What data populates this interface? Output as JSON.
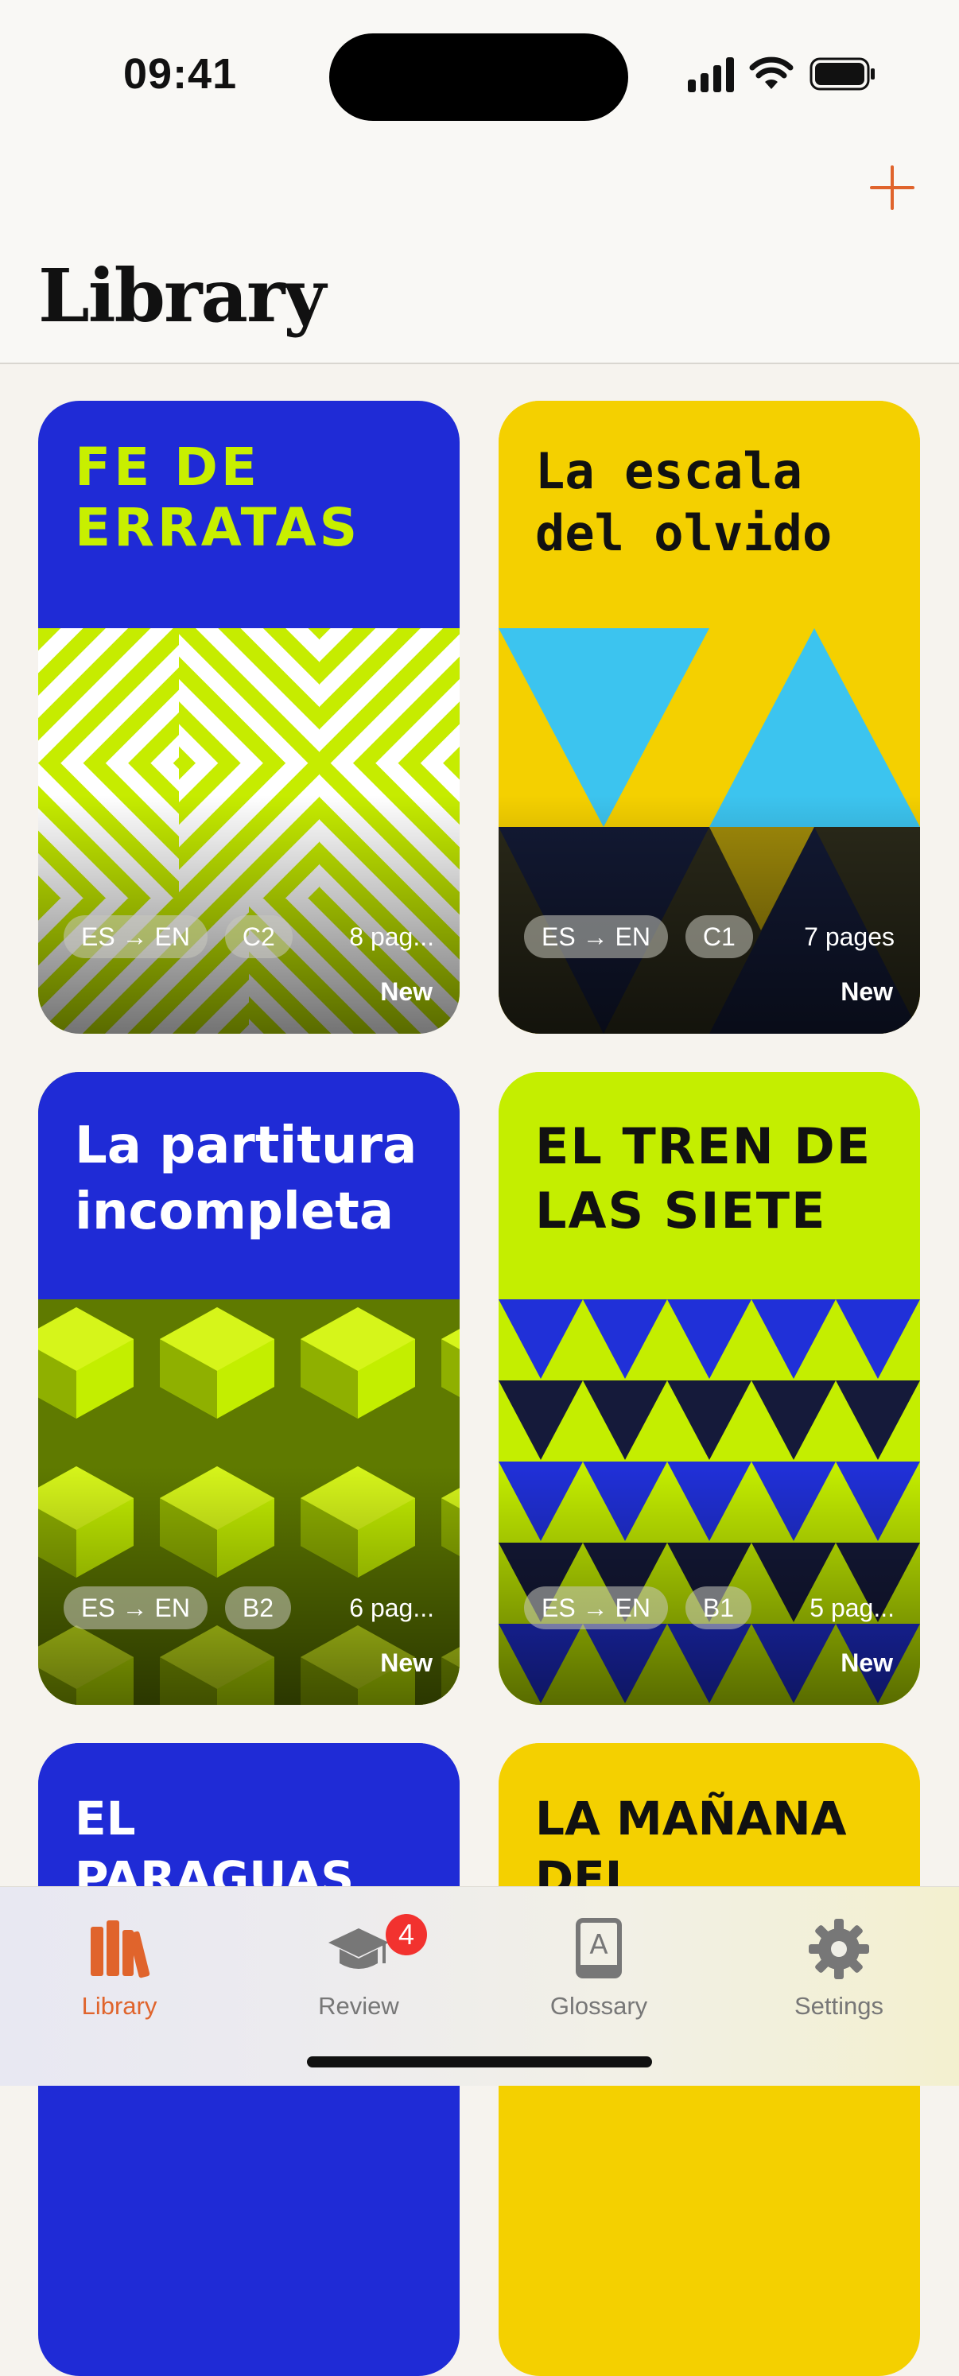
{
  "status_bar": {
    "time": "09:41"
  },
  "header": {
    "title": "Library",
    "add_icon": "plus-icon"
  },
  "books": [
    {
      "title": "FE DE ERRATAS",
      "lang": "ES → EN",
      "level": "C2",
      "pages": "8 pag...",
      "status": "New",
      "top_color": "#1f2bd6",
      "title_color": "#c8ef00"
    },
    {
      "title": "La escala del olvido",
      "lang": "ES → EN",
      "level": "C1",
      "pages": "7 pages",
      "status": "New",
      "top_color": "#f4d000",
      "title_color": "#111111"
    },
    {
      "title": "La partitura incompleta",
      "lang": "ES → EN",
      "level": "B2",
      "pages": "6 pag...",
      "status": "New",
      "top_color": "#1f2bd6",
      "title_color": "#ffffff"
    },
    {
      "title": "EL TREN DE LAS SIETE",
      "lang": "ES → EN",
      "level": "B1",
      "pages": "5 pag...",
      "status": "New",
      "top_color": "#c4ee00",
      "title_color": "#111111"
    },
    {
      "title": "EL PARAGUAS",
      "top_color": "#1f2bd6",
      "title_color": "#ffffff"
    },
    {
      "title": "LA MAÑANA DEL",
      "top_color": "#f4d000",
      "title_color": "#111111"
    }
  ],
  "tabbar": {
    "tabs": [
      {
        "label": "Library",
        "icon": "books-icon",
        "active": true
      },
      {
        "label": "Review",
        "icon": "graduation-cap-icon",
        "badge": "4"
      },
      {
        "label": "Glossary",
        "icon": "dictionary-icon"
      },
      {
        "label": "Settings",
        "icon": "gear-icon"
      }
    ],
    "active_color": "#e0642c"
  }
}
